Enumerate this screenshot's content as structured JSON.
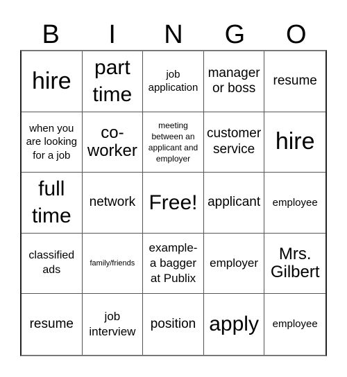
{
  "header": {
    "letters": [
      "B",
      "I",
      "N",
      "G",
      "O"
    ]
  },
  "card": {
    "rows": [
      [
        {
          "text": "hire"
        },
        {
          "text": "part time"
        },
        {
          "text": "job application"
        },
        {
          "text": "manager or boss"
        },
        {
          "text": "resume"
        }
      ],
      [
        {
          "text": "when you are looking for a job"
        },
        {
          "text": "co-worker"
        },
        {
          "text": "meeting between an applicant and employer"
        },
        {
          "text": "customer service"
        },
        {
          "text": "hire"
        }
      ],
      [
        {
          "text": "full time"
        },
        {
          "text": "network"
        },
        {
          "text": "Free!"
        },
        {
          "text": "applicant"
        },
        {
          "text": "employee"
        }
      ],
      [
        {
          "text": "classified ads"
        },
        {
          "text": "family/friends"
        },
        {
          "text": "example- a bagger at Publix"
        },
        {
          "text": "employer"
        },
        {
          "text": "Mrs. Gilbert"
        }
      ],
      [
        {
          "text": "resume"
        },
        {
          "text": "job interview"
        },
        {
          "text": "position"
        },
        {
          "text": "apply"
        },
        {
          "text": "employee"
        }
      ]
    ]
  }
}
